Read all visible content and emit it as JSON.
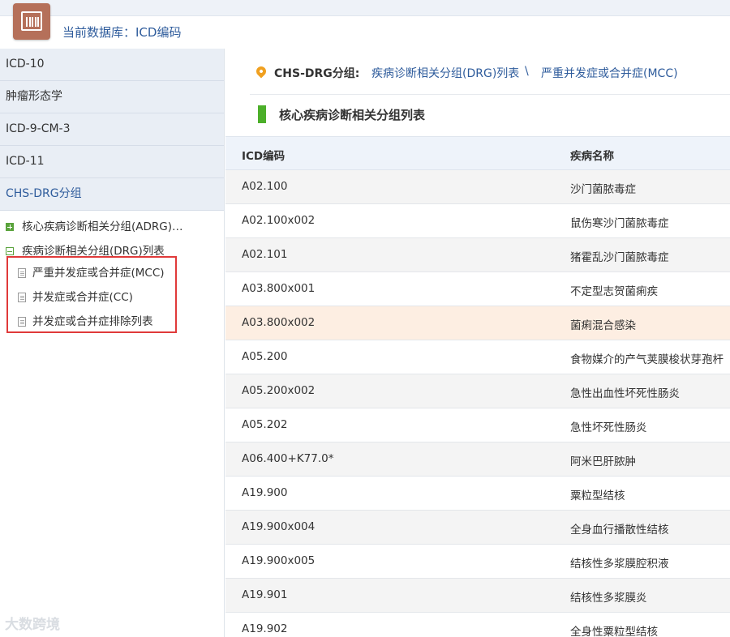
{
  "header": {
    "db_title": "当前数据库：ICD编码",
    "logo_icon": "barcode-card-icon"
  },
  "sidebar": {
    "items": [
      {
        "label": "ICD-10"
      },
      {
        "label": "肿瘤形态学"
      },
      {
        "label": "ICD-9-CM-3"
      },
      {
        "label": "ICD-11"
      },
      {
        "label": "CHS-DRG分组"
      }
    ],
    "tree": [
      {
        "label": "核心疾病诊断相关分组(ADRG)…",
        "expanded": false
      },
      {
        "label": "疾病诊断相关分组(DRG)列表",
        "expanded": true
      }
    ],
    "leaves": [
      {
        "label": "严重并发症或合并症(MCC)"
      },
      {
        "label": "并发症或合并症(CC)"
      },
      {
        "label": "并发症或合并症排除列表"
      }
    ]
  },
  "watermark": "大数跨境",
  "breadcrumb": {
    "label": "CHS-DRG分组:",
    "link1": "疾病诊断相关分组(DRG)列表",
    "sep": "\\",
    "link2": "严重并发症或合并症(MCC)"
  },
  "section_title": "核心疾病诊断相关分组列表",
  "table": {
    "headers": [
      "ICD编码",
      "疾病名称"
    ],
    "rows": [
      [
        "A02.100",
        "沙门菌脓毒症"
      ],
      [
        "A02.100x002",
        "鼠伤寒沙门菌脓毒症"
      ],
      [
        "A02.101",
        "猪霍乱沙门菌脓毒症"
      ],
      [
        "A03.800x001",
        "不定型志贺菌痢疾"
      ],
      [
        "A03.800x002",
        "菌痢混合感染"
      ],
      [
        "A05.200",
        "食物媒介的产气荚膜梭状芽孢杆"
      ],
      [
        "A05.200x002",
        "急性出血性坏死性肠炎"
      ],
      [
        "A05.202",
        "急性坏死性肠炎"
      ],
      [
        "A06.400+K77.0*",
        "阿米巴肝脓肿"
      ],
      [
        "A19.900",
        "粟粒型结核"
      ],
      [
        "A19.900x004",
        "全身血行播散性结核"
      ],
      [
        "A19.900x005",
        "结核性多浆膜腔积液"
      ],
      [
        "A19.901",
        "结核性多浆膜炎"
      ],
      [
        "A19.902",
        "全身性粟粒型结核"
      ]
    ],
    "highlighted_row": 4
  }
}
